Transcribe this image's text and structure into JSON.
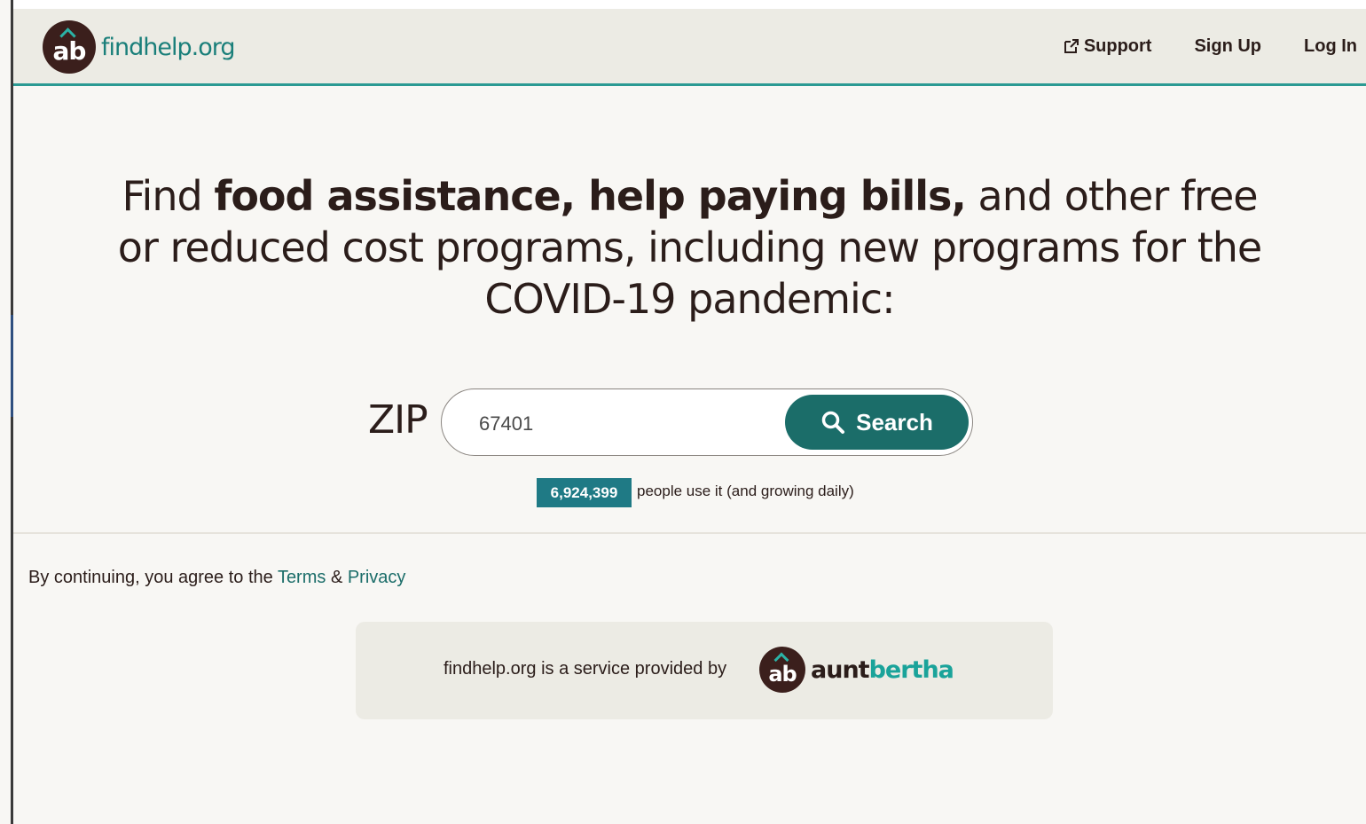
{
  "header": {
    "logo_badge": "ab",
    "logo_text": "findhelp.org",
    "nav": {
      "support": "Support",
      "sign_up": "Sign Up",
      "log_in": "Log In"
    }
  },
  "hero": {
    "heading_prefix": "Find ",
    "heading_bold": "food assistance, help paying bills,",
    "heading_suffix": " and other free or reduced cost programs, including new programs for the COVID-19 pandemic:"
  },
  "search": {
    "zip_label": "ZIP",
    "zip_value": "67401",
    "button_label": "Search"
  },
  "usage": {
    "count": "6,924,399",
    "text": "people use it (and growing daily)"
  },
  "legal": {
    "prefix": "By continuing, you agree to the ",
    "terms": "Terms",
    "amp": " & ",
    "privacy": "Privacy"
  },
  "provider": {
    "text": "findhelp.org is a service provided by",
    "badge": "ab",
    "name_part1": "aunt",
    "name_part2": "bertha"
  },
  "colors": {
    "teal_dark": "#1b6d69",
    "teal_header_line": "#2b9a93",
    "count_badge": "#1f7a85",
    "logo_dark": "#3b1f1c"
  },
  "icons": {
    "support": "external-link-icon",
    "search": "magnifier-icon"
  }
}
